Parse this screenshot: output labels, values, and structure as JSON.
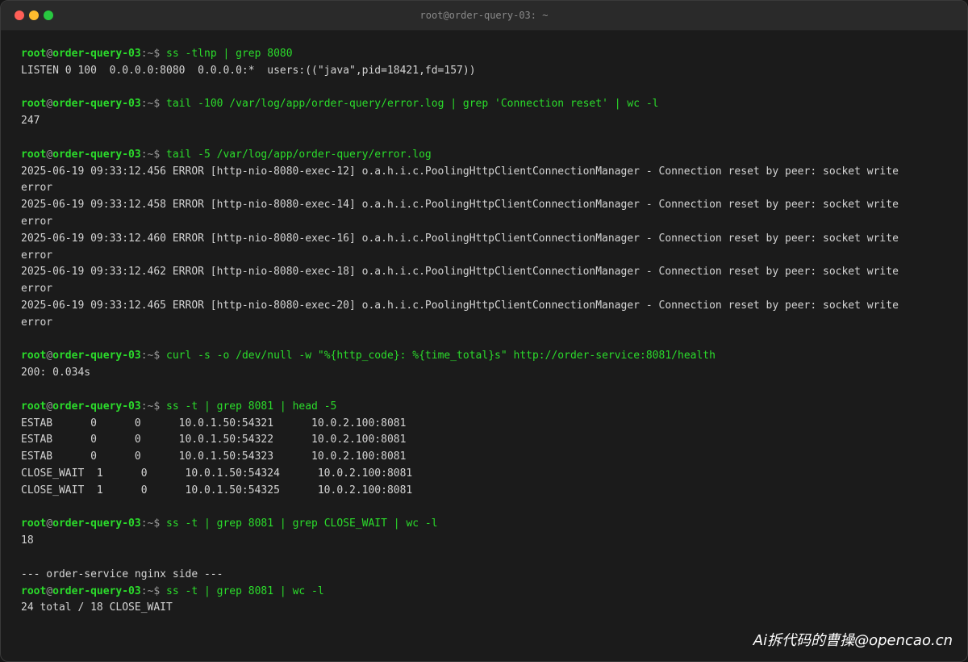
{
  "window": {
    "title": "root@order-query-03: ~",
    "traffic_lights": {
      "close": "#ff5f57",
      "minimize": "#febc2e",
      "maximize": "#28c840"
    }
  },
  "prompt": {
    "user": "root",
    "at": "@",
    "host": "order-query-03",
    "path": ":~$ "
  },
  "commands": [
    "ss -tlnp | grep 8080",
    "tail -100 /var/log/app/order-query/error.log | grep 'Connection reset' | wc -l",
    "tail -5 /var/log/app/order-query/error.log",
    "curl -s -o /dev/null -w \"%{http_code}: %{time_total}s\" http://order-service:8081/health",
    "ss -t | grep 8081 | head -5",
    "ss -t | grep 8081 | grep CLOSE_WAIT | wc -l",
    "ss -t | grep 8081 | wc -l"
  ],
  "outputs": {
    "listen": "LISTEN 0 100  0.0.0.0:8080  0.0.0.0:*  users:((\"java\",pid=18421,fd=157))",
    "reset_count": "247",
    "errors": [
      {
        "line": "2025-06-19 09:33:12.456 ERROR [http-nio-8080-exec-12] o.a.h.i.c.PoolingHttpClientConnectionManager - Connection reset by peer: socket write",
        "cont": "error"
      },
      {
        "line": "2025-06-19 09:33:12.458 ERROR [http-nio-8080-exec-14] o.a.h.i.c.PoolingHttpClientConnectionManager - Connection reset by peer: socket write",
        "cont": "error"
      },
      {
        "line": "2025-06-19 09:33:12.460 ERROR [http-nio-8080-exec-16] o.a.h.i.c.PoolingHttpClientConnectionManager - Connection reset by peer: socket write",
        "cont": "error"
      },
      {
        "line": "2025-06-19 09:33:12.462 ERROR [http-nio-8080-exec-18] o.a.h.i.c.PoolingHttpClientConnectionManager - Connection reset by peer: socket write",
        "cont": "error"
      },
      {
        "line": "2025-06-19 09:33:12.465 ERROR [http-nio-8080-exec-20] o.a.h.i.c.PoolingHttpClientConnectionManager - Connection reset by peer: socket write",
        "cont": "error"
      }
    ],
    "health": "200: 0.034s",
    "sockets": [
      "ESTAB      0      0      10.0.1.50:54321      10.0.2.100:8081",
      "ESTAB      0      0      10.0.1.50:54322      10.0.2.100:8081",
      "ESTAB      0      0      10.0.1.50:54323      10.0.2.100:8081",
      "CLOSE_WAIT  1      0      10.0.1.50:54324      10.0.2.100:8081",
      "CLOSE_WAIT  1      0      10.0.1.50:54325      10.0.2.100:8081"
    ],
    "close_wait_count": "18",
    "nginx_header": "--- order-service nginx side ---",
    "nginx_total": "24 total / 18 CLOSE_WAIT"
  },
  "watermark": "Ai拆代码的曹操@opencao.cn"
}
